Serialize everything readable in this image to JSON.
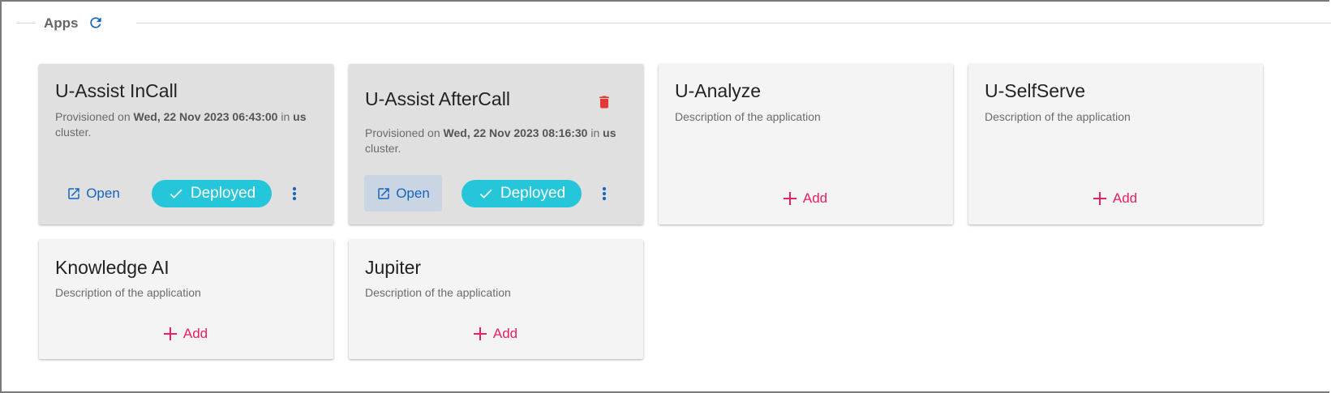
{
  "section": {
    "title": "Apps",
    "refresh_icon": "refresh-icon"
  },
  "colors": {
    "primary_blue": "#1565c0",
    "deployed_chip": "#26c6da",
    "add_pink": "#e91e63",
    "delete_red": "#e53935"
  },
  "apps": [
    {
      "title": "U-Assist InCall",
      "desc_prefix": "Provisioned on ",
      "desc_date": "Wed, 22 Nov 2023 06:43:00",
      "desc_mid": " in ",
      "desc_cluster": "us",
      "desc_suffix": " cluster.",
      "open_label": "Open",
      "status_label": "Deployed"
    },
    {
      "title": "U-Assist AfterCall",
      "desc_prefix": "Provisioned on ",
      "desc_date": "Wed, 22 Nov 2023 08:16:30",
      "desc_mid": " in ",
      "desc_cluster": "us",
      "desc_suffix": " cluster.",
      "open_label": "Open",
      "status_label": "Deployed"
    },
    {
      "title": "U-Analyze",
      "description": "Description of the application",
      "add_label": "Add"
    },
    {
      "title": "U-SelfServe",
      "description": "Description of the application",
      "add_label": "Add"
    },
    {
      "title": "Knowledge AI",
      "description": "Description of the application",
      "add_label": "Add"
    },
    {
      "title": "Jupiter",
      "description": "Description of the application",
      "add_label": "Add"
    }
  ]
}
